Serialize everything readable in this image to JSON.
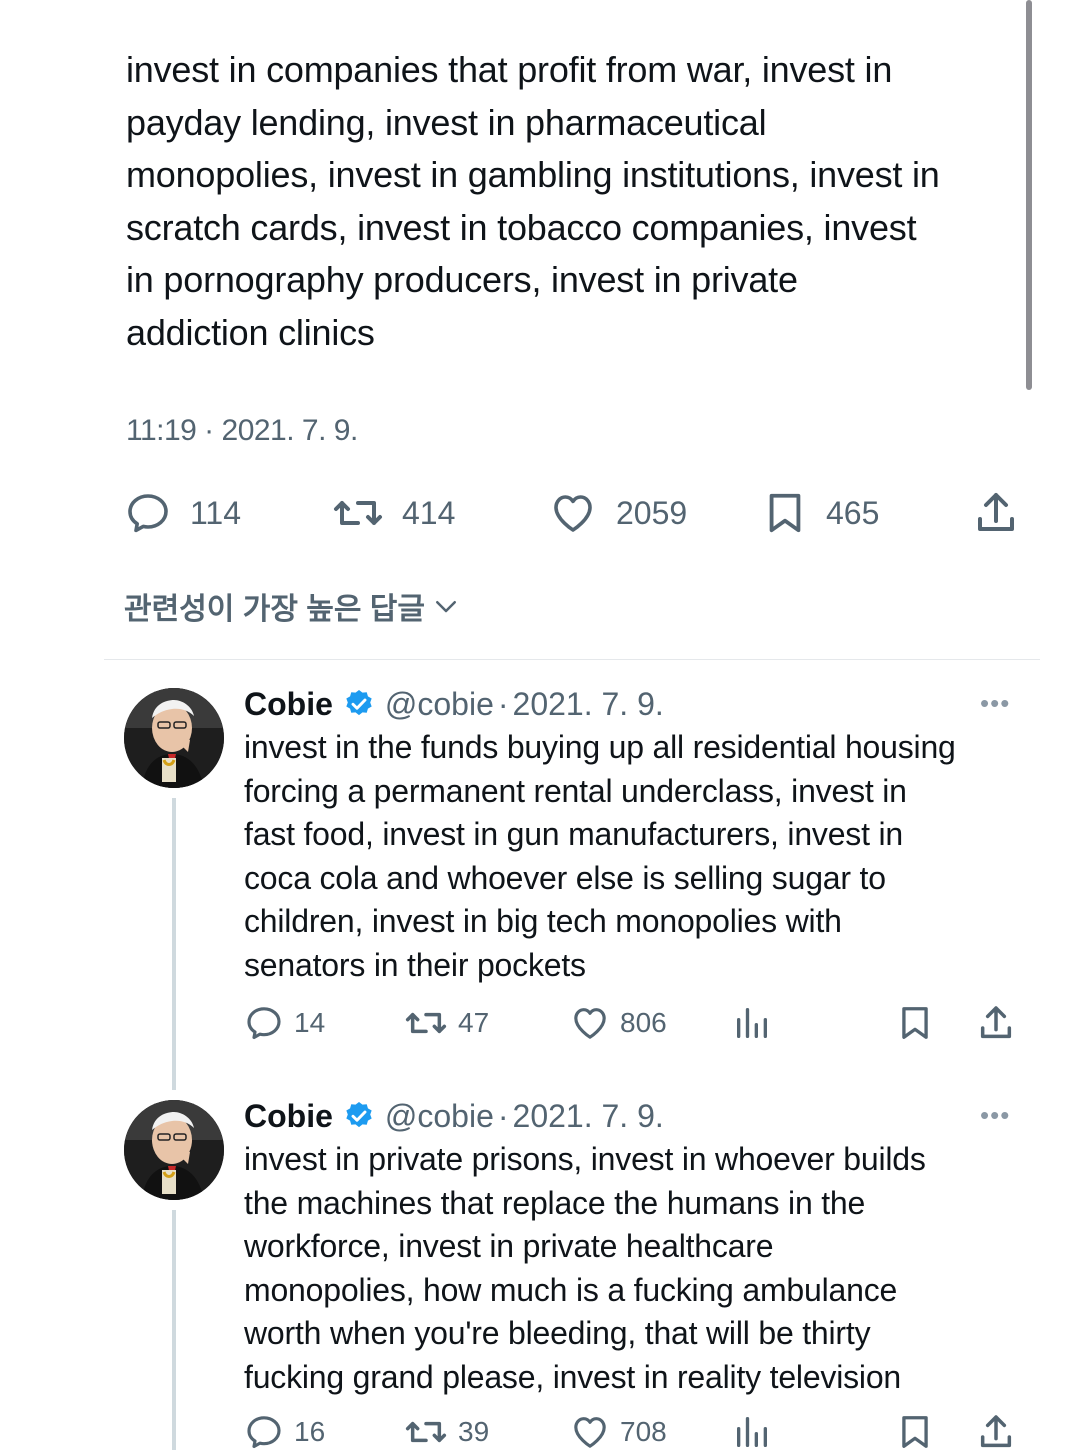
{
  "main_tweet": {
    "text": "invest in companies that profit from war, invest in\npayday lending, invest in pharmaceutical\nmonopolies, invest in gambling institutions, invest in\nscratch cards, invest in tobacco companies, invest\nin pornography producers, invest in private\naddiction clinics",
    "timestamp": "11:19 · 2021. 7. 9.",
    "actions": {
      "replies": "114",
      "retweets": "414",
      "likes": "2059",
      "bookmarks": "465"
    }
  },
  "replies_sort": {
    "label": "관련성이 가장 높은 답글"
  },
  "replies": [
    {
      "name": "Cobie",
      "handle": "@cobie",
      "date": "2021. 7. 9.",
      "text": "invest in the funds buying up all residential housing\nforcing a permanent rental underclass, invest in\nfast food, invest in gun manufacturers, invest in\ncoca cola and whoever else is selling sugar to\nchildren, invest in big tech monopolies with\nsenators in their pockets",
      "actions": {
        "replies": "14",
        "retweets": "47",
        "likes": "806"
      }
    },
    {
      "name": "Cobie",
      "handle": "@cobie",
      "date": "2021. 7. 9.",
      "text": "invest in private prisons, invest in whoever builds\nthe machines that replace the humans in the\nworkforce, invest in private healthcare\nmonopolies, how much is a fucking ambulance\nworth when you're bleeding, that will be thirty\nfucking grand please, invest in reality television",
      "actions": {
        "replies": "16",
        "retweets": "39",
        "likes": "708"
      }
    }
  ],
  "icons": {
    "reply": "reply-icon",
    "retweet": "retweet-icon",
    "like": "heart-icon",
    "bookmark": "bookmark-icon",
    "share": "share-icon",
    "views": "views-icon",
    "verified": "verified-badge-icon",
    "more": "more-icon",
    "chevron": "chevron-down-icon"
  },
  "colors": {
    "text": "#0f1419",
    "secondary": "#536471",
    "verified": "#1d9bf0",
    "divider": "#e5e8eb"
  }
}
